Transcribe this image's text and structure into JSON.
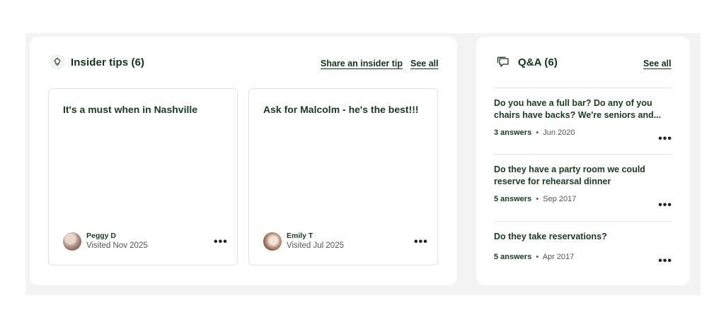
{
  "insider_tips": {
    "title": "Insider tips (6)",
    "icon": "lightbulb-icon",
    "share_link": "Share an insider tip",
    "see_all": "See all",
    "tips": [
      {
        "text": "It's a must when in Nashville",
        "author": "Peggy D",
        "visited": "Visited Nov 2025"
      },
      {
        "text": "Ask for Malcolm - he's the best!!!",
        "author": "Emily T",
        "visited": "Visited Jul 2025"
      }
    ]
  },
  "qa": {
    "title": "Q&A (6)",
    "icon": "chat-bubbles-icon",
    "see_all": "See all",
    "questions": [
      {
        "text": "Do you have a full bar? Do any of you chairs have backs? We're seniors and...",
        "answers": "3 answers",
        "date": "Jun 2020"
      },
      {
        "text": "Do they have a party room we could reserve for rehearsal dinner",
        "answers": "5 answers",
        "date": "Sep 2017"
      },
      {
        "text": "Do they take reservations?",
        "answers": "5 answers",
        "date": "Apr 2017"
      }
    ]
  },
  "more_glyph": "•••"
}
